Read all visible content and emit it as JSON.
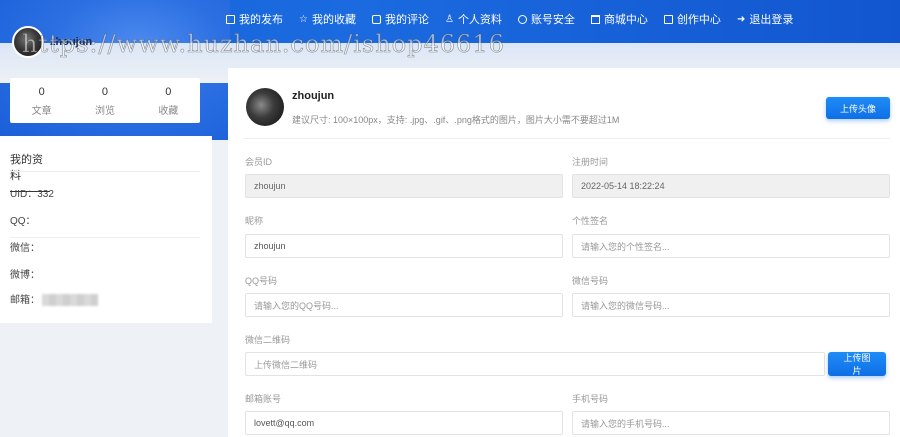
{
  "nav": {
    "items": [
      {
        "icon": "document-icon",
        "label": "我的发布"
      },
      {
        "icon": "star-icon",
        "label": "我的收藏"
      },
      {
        "icon": "comment-icon",
        "label": "我的评论"
      },
      {
        "icon": "user-icon",
        "label": "个人资料"
      },
      {
        "icon": "shield-icon",
        "label": "账号安全"
      },
      {
        "icon": "shop-icon",
        "label": "商城中心"
      },
      {
        "icon": "edit-icon",
        "label": "创作中心"
      },
      {
        "icon": "logout-icon",
        "label": "退出登录"
      }
    ]
  },
  "user": {
    "name": "zhoujun",
    "stats": [
      {
        "value": "0",
        "label": "文章"
      },
      {
        "value": "0",
        "label": "浏览"
      },
      {
        "value": "0",
        "label": "收藏"
      }
    ]
  },
  "profile": {
    "title": "我的资料",
    "uid": "UID：332",
    "qq": "QQ：",
    "wechat": "微信：",
    "weibo": "微博：",
    "email": "邮箱："
  },
  "main": {
    "name": "zhoujun",
    "hint": "建议尺寸: 100×100px，支持: .jpg、.gif、.png格式的图片，图片大小需不要超过1M",
    "upload_avatar": "上传头像",
    "upload_image": "上传图片",
    "fields": {
      "member_id": {
        "label": "会员ID",
        "value": "zhoujun"
      },
      "reg_time": {
        "label": "注册时间",
        "value": "2022-05-14 18:22:24"
      },
      "nickname": {
        "label": "昵称",
        "value": "zhoujun"
      },
      "signature": {
        "label": "个性签名",
        "placeholder": "请输入您的个性签名..."
      },
      "qq": {
        "label": "QQ号码",
        "placeholder": "请输入您的QQ号码..."
      },
      "wechat": {
        "label": "微信号码",
        "placeholder": "请输入您的微信号码..."
      },
      "wechat_qr": {
        "label": "微信二维码",
        "placeholder": "上传微信二维码"
      },
      "email": {
        "label": "邮箱账号",
        "value": "lovett@qq.com"
      },
      "phone": {
        "label": "手机号码",
        "placeholder": "请输入您的手机号码..."
      }
    }
  },
  "watermark": "https://www.huzhan.com/ishop46616"
}
